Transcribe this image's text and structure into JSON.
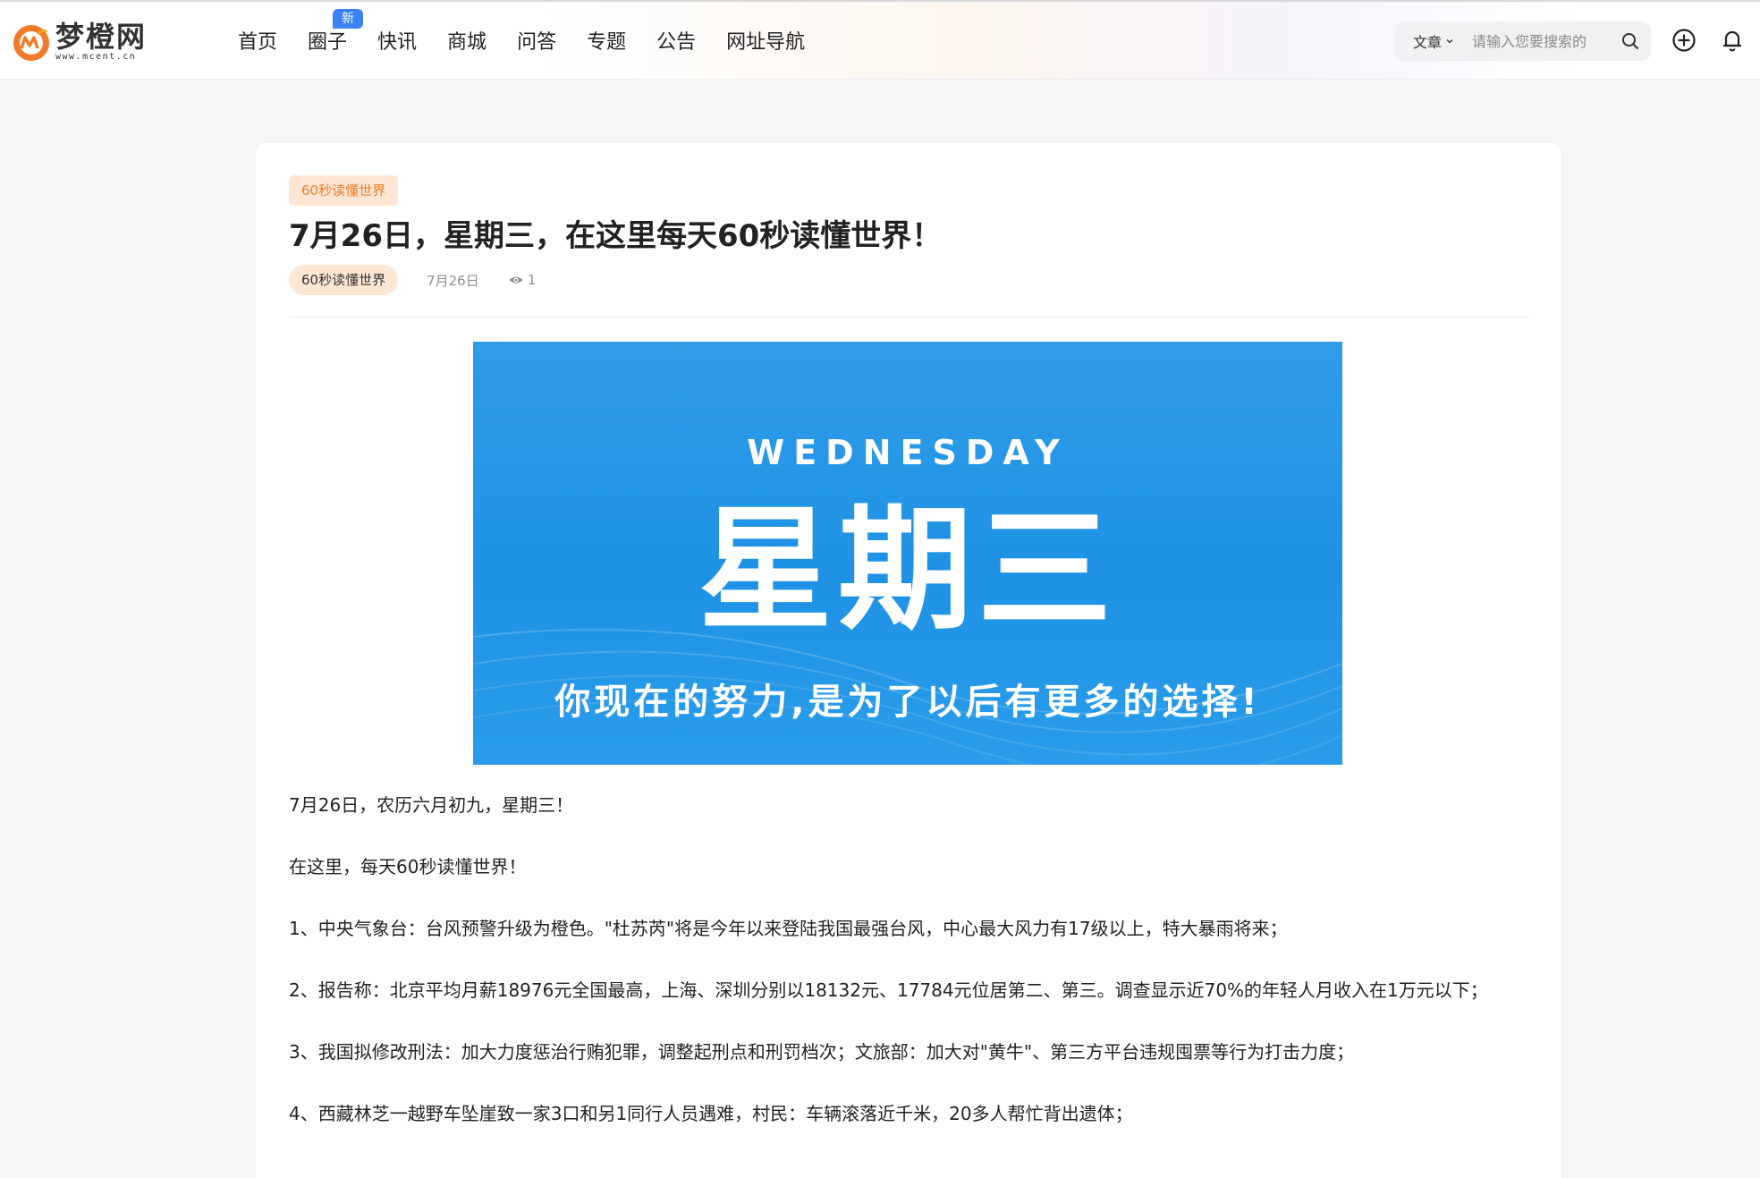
{
  "site": {
    "logo_cn": "梦橙网",
    "logo_url": "www.mcent.cn",
    "brand_color": "#f07b2a"
  },
  "nav": {
    "items": [
      {
        "label": "首页"
      },
      {
        "label": "圈子",
        "badge": "新"
      },
      {
        "label": "快讯"
      },
      {
        "label": "商城"
      },
      {
        "label": "问答"
      },
      {
        "label": "专题"
      },
      {
        "label": "公告"
      },
      {
        "label": "网址导航"
      }
    ]
  },
  "search": {
    "type_label": "文章",
    "placeholder": "请输入您要搜索的"
  },
  "header_icons": [
    "search-icon",
    "add-circle-icon",
    "bell-icon"
  ],
  "article": {
    "top_tag": "60秒读懂世界",
    "title": "7月26日，星期三，在这里每天60秒读懂世界！",
    "category": "60秒读懂世界",
    "date": "7月26日",
    "views": "1",
    "banner": {
      "english": "WEDNESDAY",
      "chinese": "星期三",
      "slogan": "你现在的努力,是为了以后有更多的选择!",
      "color": "#2496e8"
    },
    "paragraphs": [
      "7月26日，农历六月初九，星期三！",
      "在这里，每天60秒读懂世界！",
      "1、中央气象台：台风预警升级为橙色。\"杜苏芮\"将是今年以来登陆我国最强台风，中心最大风力有17级以上，特大暴雨将来；",
      "2、报告称：北京平均月薪18976元全国最高，上海、深圳分别以18132元、17784元位居第二、第三。调查显示近70%的年轻人月收入在1万元以下；",
      "3、我国拟修改刑法：加大力度惩治行贿犯罪，调整起刑点和刑罚档次；文旅部：加大对\"黄牛\"、第三方平台违规囤票等行为打击力度；",
      "4、西藏林芝一越野车坠崖致一家3口和另1同行人员遇难，村民：车辆滚落近千米，20多人帮忙背出遗体；"
    ]
  }
}
